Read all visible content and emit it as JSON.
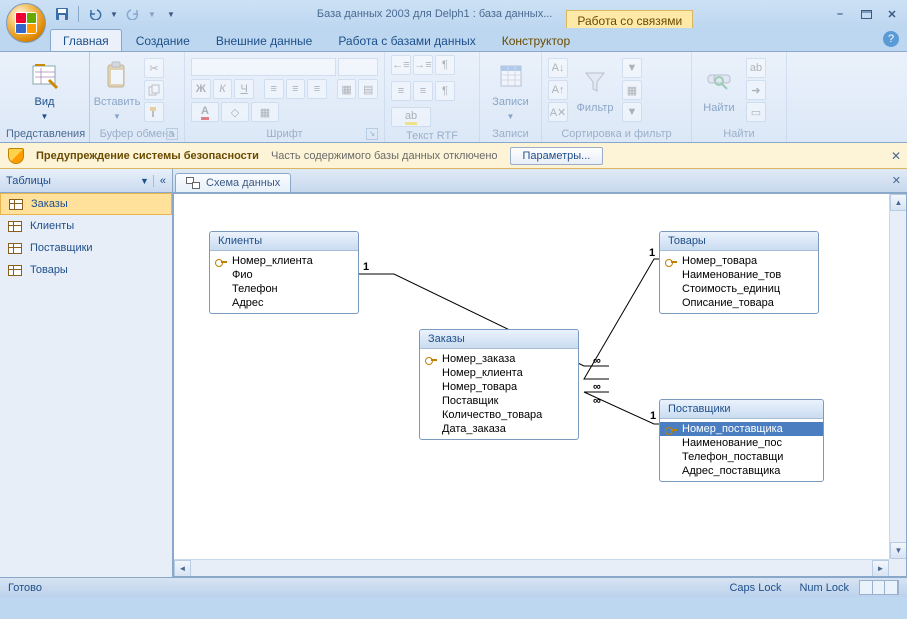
{
  "title": "База данных 2003 для Delph1 : база данных...",
  "context_tab": "Работа со связями",
  "qat": {
    "save": "save",
    "undo": "undo",
    "redo": "redo"
  },
  "tabs": [
    "Главная",
    "Создание",
    "Внешние данные",
    "Работа с базами данных",
    "Конструктор"
  ],
  "active_tab": 0,
  "ribbon": {
    "groups": {
      "views": {
        "label": "Представления",
        "btn": "Вид"
      },
      "clipboard": {
        "label": "Буфер обмена",
        "btn": "Вставить"
      },
      "font": {
        "label": "Шрифт"
      },
      "richtext": {
        "label": "Текст RTF"
      },
      "records": {
        "label": "Записи",
        "btn": "Записи"
      },
      "sortfilter": {
        "label": "Сортировка и фильтр",
        "btn": "Фильтр"
      },
      "find": {
        "label": "Найти",
        "btn": "Найти"
      }
    }
  },
  "security": {
    "title": "Предупреждение системы безопасности",
    "message": "Часть содержимого базы данных отключено",
    "button": "Параметры..."
  },
  "navpane": {
    "header": "Таблицы",
    "items": [
      "Заказы",
      "Клиенты",
      "Поставщики",
      "Товары"
    ],
    "selected": 0
  },
  "doc_tab": "Схема данных",
  "tables": {
    "klienty": {
      "title": "Клиенты",
      "fields": [
        "Номер_клиента",
        "Фио",
        "Телефон",
        "Адрес"
      ],
      "keys": [
        0
      ]
    },
    "zakazy": {
      "title": "Заказы",
      "fields": [
        "Номер_заказа",
        "Номер_клиента",
        "Номер_товара",
        "Поставщик",
        "Количество_товара",
        "Дата_заказа"
      ],
      "keys": [
        0
      ]
    },
    "tovary": {
      "title": "Товары",
      "fields": [
        "Номер_товара",
        "Наименование_тов",
        "Стоимость_единиц",
        "Описание_товара"
      ],
      "keys": [
        0
      ]
    },
    "postavshiki": {
      "title": "Поставщики",
      "fields": [
        "Номер_поставщика",
        "Наименование_пос",
        "Телефон_поставщи",
        "Адрес_поставщика"
      ],
      "keys": [
        0
      ],
      "selected": 0
    }
  },
  "rel_labels": {
    "one": "1",
    "many": "∞"
  },
  "status": {
    "ready": "Готово",
    "caps": "Caps Lock",
    "num": "Num Lock"
  }
}
